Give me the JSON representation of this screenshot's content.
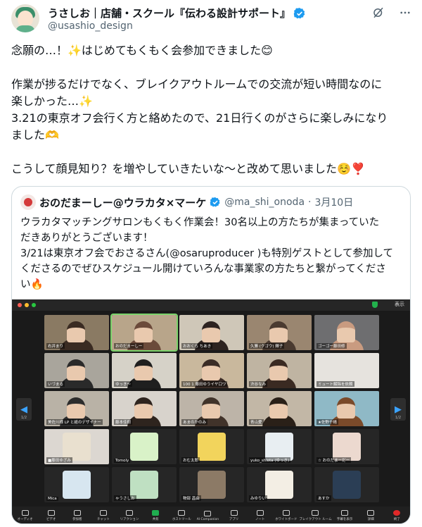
{
  "author": {
    "display_name": "うさしお｜店舗・スクール『伝わる設計サポート』",
    "handle": "@usashio_design"
  },
  "header_icons": [
    "grok-icon",
    "more-icon"
  ],
  "tweet": {
    "lines": [
      "念願の…！✨はじめてもくもく会参加できました😊",
      "",
      "作業が捗るだけでなく、ブレイクアウトルームでの交流が短い時間なのに",
      "楽しかった…✨",
      "3.21の東京オフ会行く方と絡めたので、21日行くのがさらに楽しみになり",
      "ました🫶",
      "",
      "こうして顔見知り？を増やしていきたいな〜と改めて思いました☺️❣️"
    ]
  },
  "quote": {
    "display_name": "おのだまーしー@ウラカタ×マーケ",
    "handle": "@ma_shi_onoda",
    "separator": "·",
    "date": "3月10日",
    "lines": [
      "ウラカタマッチングサロンもくもく作業会！30名以上の方たちが集まっていた",
      "だきありがとうございます！",
      "3/21は東京オフ会でおさるさん(@osaruproducer )も特別ゲストとして参加して",
      "くださるのでぜひスケジュール開けていろんな事業家の方たちと繋がってくださ",
      "い🔥"
    ]
  },
  "zoom": {
    "view_label": "表示",
    "page_label": "1/2",
    "participants": [
      "右井まり",
      "おのだまーしー",
      "おおくら ちあき",
      "久勝 (クゴウ) 輝子",
      "ゴーゴー藤田修",
      "いづまる",
      "ゆっき〜",
      "100 1 藤田ゆうイヤ口ワ",
      "渋谷なみ",
      "ミュート解除を依頼",
      "美佐川様 LP と紙のデザイナー",
      "藤本佳樹",
      "あまのかのみ",
      "青山愛",
      "★佐野千晴",
      "■藤田ゆざみ",
      "Tomoly",
      "おむ太郎",
      "yuko_shiota (ゆっき)",
      "☆ おのだまーだー",
      "Mica",
      "ゃうさしお",
      "物部 昌由",
      "みゆりい",
      "あすか"
    ],
    "toolbar": [
      "オーディオ",
      "ビデオ",
      "参加者",
      "チャット",
      "リアクション",
      "共有",
      "ホストツール",
      "AI Companion",
      "アプリ",
      "ノート",
      "ホワイトボード",
      "ブレイクアウト ルーム",
      "字幕を表示",
      "詳細",
      "終了"
    ]
  }
}
